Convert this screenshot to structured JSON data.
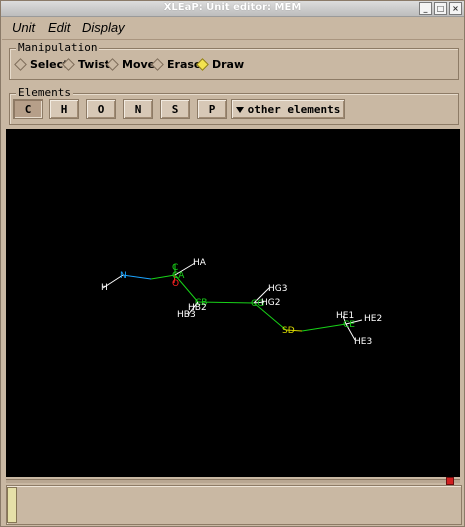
{
  "window": {
    "title": "XLEaP: Unit editor: MEM",
    "buttons": [
      "_",
      "□",
      "×"
    ]
  },
  "menu": {
    "items": [
      "Unit",
      "Edit",
      "Display"
    ]
  },
  "manipulation": {
    "label": "Manipulation",
    "options": [
      "Select",
      "Twist",
      "Move",
      "Erase",
      "Draw"
    ],
    "selected": "Draw"
  },
  "elements": {
    "label": "Elements",
    "buttons": [
      "C",
      "H",
      "O",
      "N",
      "S",
      "P"
    ],
    "selected": "C",
    "other_label": "other elements"
  },
  "molecule": {
    "atoms": [
      "H",
      "N",
      "C",
      "CA",
      "O",
      "HA",
      "CB",
      "HB2",
      "HB3",
      "CG",
      "HG3",
      "HG2",
      "SD",
      "HE1",
      "CE",
      "HE2",
      "HE3"
    ]
  },
  "colors": {
    "background": "#c9b8a3",
    "canvas": "#000000",
    "nitrogen": "#1ba4ff",
    "carbon": "#18d218",
    "oxygen": "#ff2222",
    "sulfur": "#d8d800",
    "hydrogen": "#ffffff"
  }
}
